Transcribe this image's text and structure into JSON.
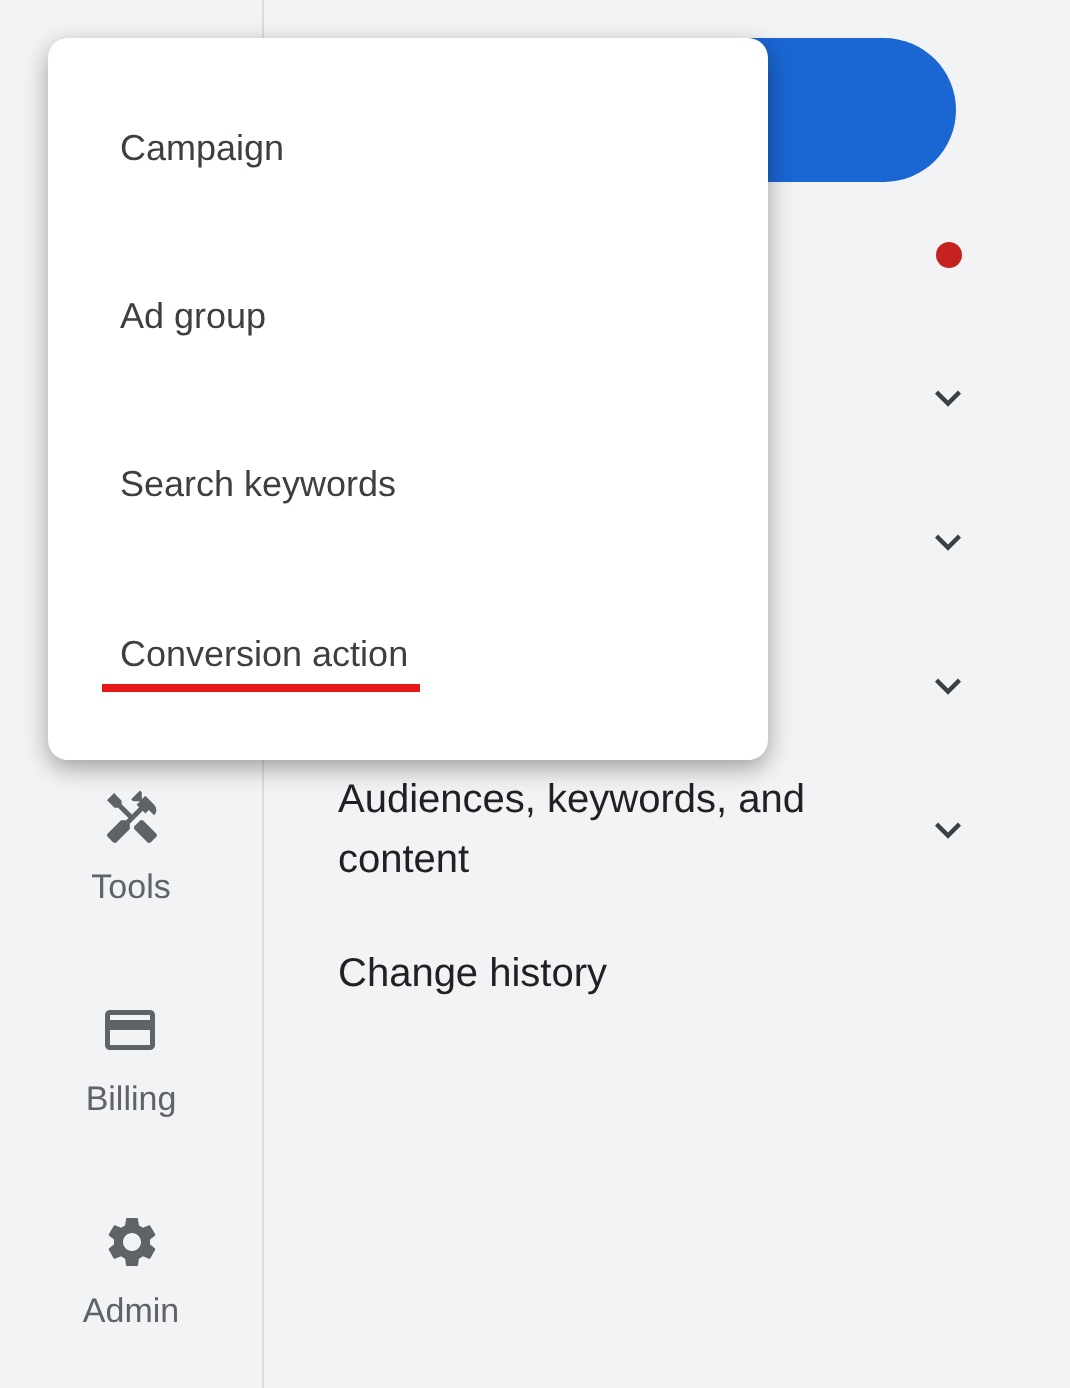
{
  "create_menu": {
    "items": [
      {
        "label": "Campaign",
        "underlined": false
      },
      {
        "label": "Ad group",
        "underlined": false
      },
      {
        "label": "Search keywords",
        "underlined": false
      },
      {
        "label": "Conversion action",
        "underlined": true
      }
    ]
  },
  "sidebar": {
    "items": [
      {
        "label": "Tools",
        "kind": "tools"
      },
      {
        "label": "Billing",
        "kind": "billing"
      },
      {
        "label": "Admin",
        "kind": "admin"
      }
    ]
  },
  "main": {
    "nav_items": [
      {
        "kind": "alert"
      },
      {
        "kind": "expandable"
      },
      {
        "kind": "expandable"
      },
      {
        "kind": "expandable"
      },
      {
        "kind": "expandable",
        "label": "Audiences, keywords, and content"
      },
      {
        "kind": "plain",
        "label": "Change history"
      }
    ]
  }
}
